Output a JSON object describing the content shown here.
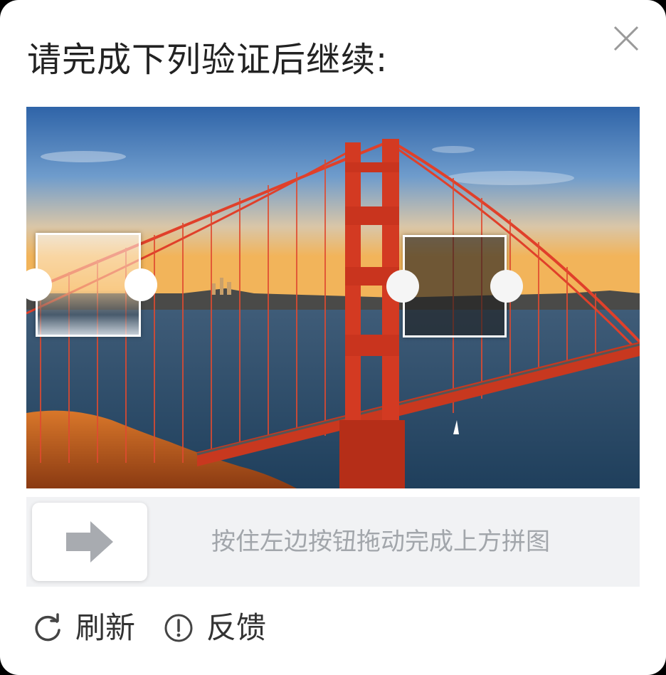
{
  "dialog": {
    "title": "请完成下列验证后继续:"
  },
  "icons": {
    "close": "close-icon",
    "arrow": "arrow-right-icon",
    "refresh": "refresh-icon",
    "feedback": "exclamation-circle-icon"
  },
  "slider": {
    "hint": "按住左边按钮拖动完成上方拼图"
  },
  "footer": {
    "refresh_label": "刷新",
    "feedback_label": "反馈"
  },
  "colors": {
    "accent_bridge": "#e0402a",
    "sky_top": "#3a6fb0",
    "track_bg": "#f1f2f4",
    "hint_text": "#a2a6ab"
  }
}
